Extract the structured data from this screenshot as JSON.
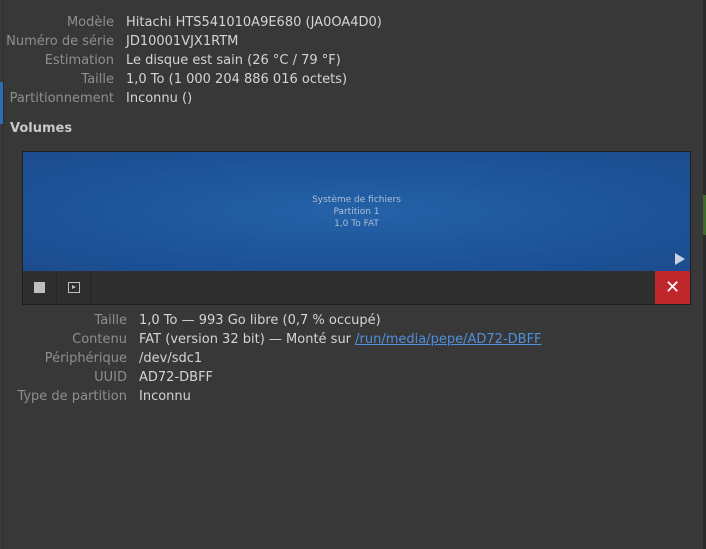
{
  "drive": {
    "rows": [
      {
        "label": "Modèle",
        "value": "Hitachi HTS541010A9E680 (JA0OA4D0)"
      },
      {
        "label": "Numéro de série",
        "value": "JD10001VJX1RTM"
      },
      {
        "label": "Estimation",
        "value": "Le disque est sain (26 °C / 79 °F)"
      },
      {
        "label": "Taille",
        "value": "1,0 To (1 000 204 886 016 octets)"
      },
      {
        "label": "Partitionnement",
        "value": "Inconnu ()"
      }
    ]
  },
  "volumes": {
    "title": "Volumes",
    "partition": {
      "line1": "Système de fichiers",
      "line2": "Partition 1",
      "line3": "1,0 To FAT"
    },
    "toolbar": {
      "stop_icon": "stop-icon",
      "mount_icon": "mount-icon",
      "delete_icon": "close-icon",
      "delete_glyph": "✕",
      "delete_color": "#c0272d"
    },
    "details": {
      "size_label": "Taille",
      "size_value": "1,0 To — 993 Go libre (0,7 % occupé)",
      "content_label": "Contenu",
      "content_prefix": "FAT (version 32 bit) — Monté sur ",
      "content_link": "/run/media/pepe/AD72-DBFF",
      "device_label": "Périphérique",
      "device_value": "/dev/sdc1",
      "uuid_label": "UUID",
      "uuid_value": "AD72-DBFF",
      "ptype_label": "Type de partition",
      "ptype_value": "Inconnu"
    }
  },
  "colors": {
    "background": "#383838",
    "partition_fill": "#1d5196",
    "link": "#4f8fdd",
    "accent": "#2d6db5"
  }
}
